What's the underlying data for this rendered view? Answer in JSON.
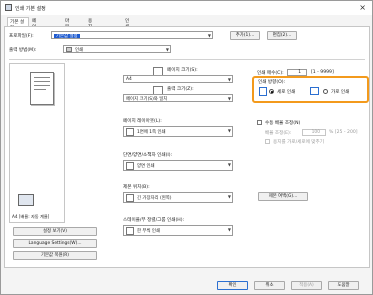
{
  "window": {
    "title": "인쇄 기본 설정"
  },
  "tabs": [
    "기본 설정",
    "페이지 설정",
    "마무리",
    "용지 공급장치",
    "인쇄 품질"
  ],
  "profile": {
    "label": "프로파일(F):",
    "value": "기본값 설정",
    "add_btn": "추가(1)...",
    "edit_btn": "편집(2)..."
  },
  "output_method": {
    "label": "출력 방법(M):",
    "value": "인쇄"
  },
  "preview": {
    "label": "A4 [배율: 자동 계율]"
  },
  "page_size": {
    "label": "페이지 크기(S):",
    "value": "A4"
  },
  "output_size": {
    "label": "출력 크기(Z):",
    "value": "페이지 크기(S)와 일치"
  },
  "copies": {
    "label": "인쇄 매수(C):",
    "value": "1",
    "range": "[1 - 9999]"
  },
  "orientation": {
    "label": "인쇄 방향(O):",
    "portrait": "세로 인쇄",
    "landscape": "가로 인쇄",
    "selected": "portrait"
  },
  "page_layout": {
    "label": "페이지 레이아웃(L):",
    "value": "1면에 1쪽 인쇄"
  },
  "manual_scaling": {
    "label": "수동 배율 조정(N)",
    "scale_label": "배율 조정(E):",
    "scale_value": "100",
    "scale_range": "% [25 - 200]",
    "fit_label": "용지를 가로/세로에 맞추기"
  },
  "duplex": {
    "label": "단면/양면/소책자 인쇄(I):",
    "value": "양면 인쇄"
  },
  "binding": {
    "label": "제본 위치(B):",
    "value": "긴 가장자리 (왼쪽)",
    "margin_btn": "제본 여백(G)..."
  },
  "stapling": {
    "label": "스테이플/부 정렬/그룹 인쇄(H):",
    "value": "한 부씩 인쇄"
  },
  "side_buttons": {
    "view_settings": "설정 보기(V)",
    "language": "Language Settings(W)...",
    "restore": "기본값 복원(R)"
  },
  "footer": {
    "ok": "확인",
    "cancel": "취소",
    "apply": "적용(A)",
    "help": "도움말"
  }
}
